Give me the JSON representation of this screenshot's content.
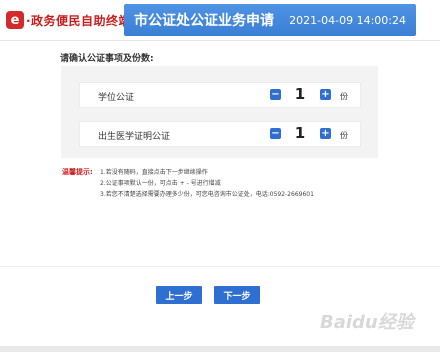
{
  "header": {
    "logo_mark": "e",
    "logo_text": "·政务便民自助终端",
    "title": "市公证处公证业务申请",
    "datetime": "2021-04-09 14:00:24"
  },
  "main": {
    "prompt": "请确认公证事项及份数:",
    "items": [
      {
        "label": "学位公证",
        "minus": "−",
        "quantity": "1",
        "plus": "+",
        "unit": "份"
      },
      {
        "label": "出生医学证明公证",
        "minus": "−",
        "quantity": "1",
        "plus": "+",
        "unit": "份"
      }
    ]
  },
  "tips": {
    "label": "温馨提示:",
    "lines": [
      "1.若没有随码，直接点击下一步继续操作",
      "2.公证事项默认一份，可点击 + - 号进行增减",
      "3.若您不清楚选择需要办理多少份，可您电咨询市公证处，电话:0592-2669601"
    ]
  },
  "buttons": {
    "prev": "上一步",
    "next": "下一步"
  },
  "watermark": "Baidu经验",
  "colors": {
    "accent": "#2f6fd1",
    "header_bar": "#4a8de0",
    "brand_red": "#c81e1e",
    "panel_bg": "#f3f3f3"
  }
}
